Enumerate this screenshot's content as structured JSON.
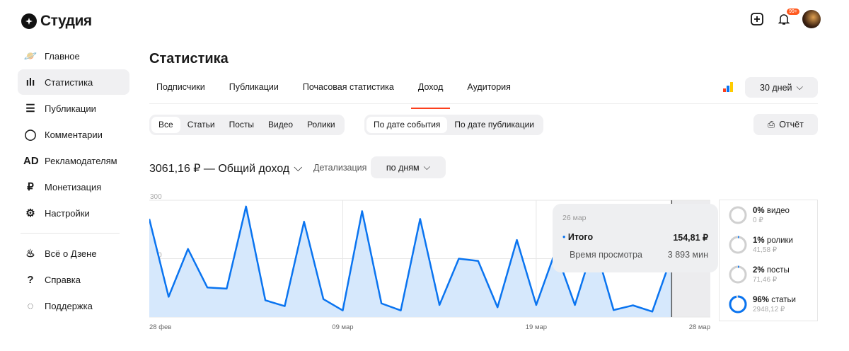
{
  "brand": "Студия",
  "header": {
    "notif_badge": "99+"
  },
  "sidebar": {
    "items": [
      {
        "label": "Главное",
        "icon": "planet-icon",
        "glyph": "🪐"
      },
      {
        "label": "Статистика",
        "icon": "bar-chart-icon",
        "glyph": "ılı",
        "active": true
      },
      {
        "label": "Публикации",
        "icon": "publications-icon",
        "glyph": "☰"
      },
      {
        "label": "Комментарии",
        "icon": "comment-icon",
        "glyph": "◯"
      },
      {
        "label": "Рекламодателям",
        "icon": "ad-icon",
        "glyph": "AD"
      },
      {
        "label": "Монетизация",
        "icon": "ruble-icon",
        "glyph": "₽"
      },
      {
        "label": "Настройки",
        "icon": "gear-icon",
        "glyph": "⚙"
      }
    ],
    "bottom": [
      {
        "label": "Всё о Дзене",
        "icon": "flame-icon",
        "glyph": "♨"
      },
      {
        "label": "Справка",
        "icon": "help-icon",
        "glyph": "?"
      },
      {
        "label": "Поддержка",
        "icon": "support-icon",
        "glyph": "◌"
      }
    ]
  },
  "page_title": "Статистика",
  "tabs": [
    "Подписчики",
    "Публикации",
    "Почасовая статистика",
    "Доход",
    "Аудитория"
  ],
  "active_tab": 3,
  "period": "30 дней",
  "content_filter": [
    "Все",
    "Статьи",
    "Посты",
    "Видео",
    "Ролики"
  ],
  "date_filter": [
    "По дате события",
    "По дате публикации"
  ],
  "report_label": "Отчёт",
  "total": "3061,16 ₽ — Общий доход",
  "detail_label": "Детализация",
  "detail_value": "по дням",
  "tooltip": {
    "date": "26 мар",
    "total_label": "Итого",
    "total_value": "154,81 ₽",
    "time_label": "Время просмотра",
    "time_value": "3 893 мин"
  },
  "breakdown": [
    {
      "pct": "0%",
      "name": "видео",
      "amount": "0 ₽",
      "fraction": 0
    },
    {
      "pct": "1%",
      "name": "ролики",
      "amount": "41,58 ₽",
      "fraction": 0.01
    },
    {
      "pct": "2%",
      "name": "посты",
      "amount": "71,46 ₽",
      "fraction": 0.02
    },
    {
      "pct": "96%",
      "name": "статьи",
      "amount": "2948,12 ₽",
      "fraction": 0.96
    }
  ],
  "chart_data": {
    "type": "area",
    "ylim": [
      0,
      300
    ],
    "yticks": [
      "0",
      "150",
      "300"
    ],
    "xticks": [
      {
        "label": "28 фев",
        "i": 0
      },
      {
        "label": "09 мар",
        "i": 10
      },
      {
        "label": "19 мар",
        "i": 20
      },
      {
        "label": "28 мар",
        "i": 29
      }
    ],
    "x_count": 30,
    "hover_index": 27,
    "values": [
      252,
      52,
      175,
      76,
      73,
      284,
      43,
      28,
      245,
      46,
      17,
      272,
      35,
      17,
      252,
      31,
      150,
      144,
      25,
      198,
      31,
      170,
      31,
      190,
      18,
      30,
      14,
      155
    ],
    "color": "#0a74f0"
  }
}
